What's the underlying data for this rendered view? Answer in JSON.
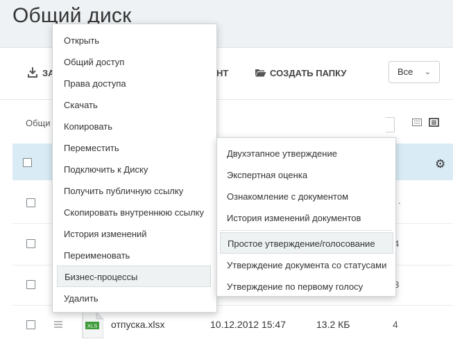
{
  "page": {
    "title": "Общий диск"
  },
  "toolbar": {
    "upload_label": "ЗА",
    "document_label": "НТ",
    "create_folder_label": "СОЗДАТЬ ПАПКУ",
    "filter": {
      "selected": "Все"
    }
  },
  "breadcrumb": "Общи",
  "rows": [
    {
      "tail": "."
    },
    {
      "tail": "4"
    },
    {
      "tail": "3"
    },
    {
      "name": "отпуска.xlsx",
      "type_badge": "XLS",
      "date": "10.12.2012 15:47",
      "size": "13.2 КБ",
      "tail": "4"
    }
  ],
  "context_menu": {
    "items": [
      {
        "label": "Открыть"
      },
      {
        "label": "Общий доступ"
      },
      {
        "label": "Права доступа"
      },
      {
        "label": "Скачать"
      },
      {
        "label": "Копировать"
      },
      {
        "label": "Переместить"
      },
      {
        "label": "Подключить к Диску"
      },
      {
        "label": "Получить публичную ссылку"
      },
      {
        "label": "Скопировать внутреннюю ссылку"
      },
      {
        "label": "История изменений"
      },
      {
        "label": "Переименовать"
      },
      {
        "label": "Бизнес-процессы"
      },
      {
        "label": "Удалить"
      }
    ]
  },
  "submenu": {
    "items": [
      {
        "label": "Двухэтапное утверждение"
      },
      {
        "label": "Экспертная оценка"
      },
      {
        "label": "Ознакомление с документом"
      },
      {
        "label": "История изменений документов"
      },
      {
        "label": "Простое утверждение/голосование"
      },
      {
        "label": "Утверждение документа со статусами"
      },
      {
        "label": "Утверждение по первому голосу"
      }
    ]
  },
  "colors": {
    "header_bg": "#eef2f4",
    "selected_row_bg": "#d9ecf6",
    "xls_badge": "#3f9b3b"
  }
}
